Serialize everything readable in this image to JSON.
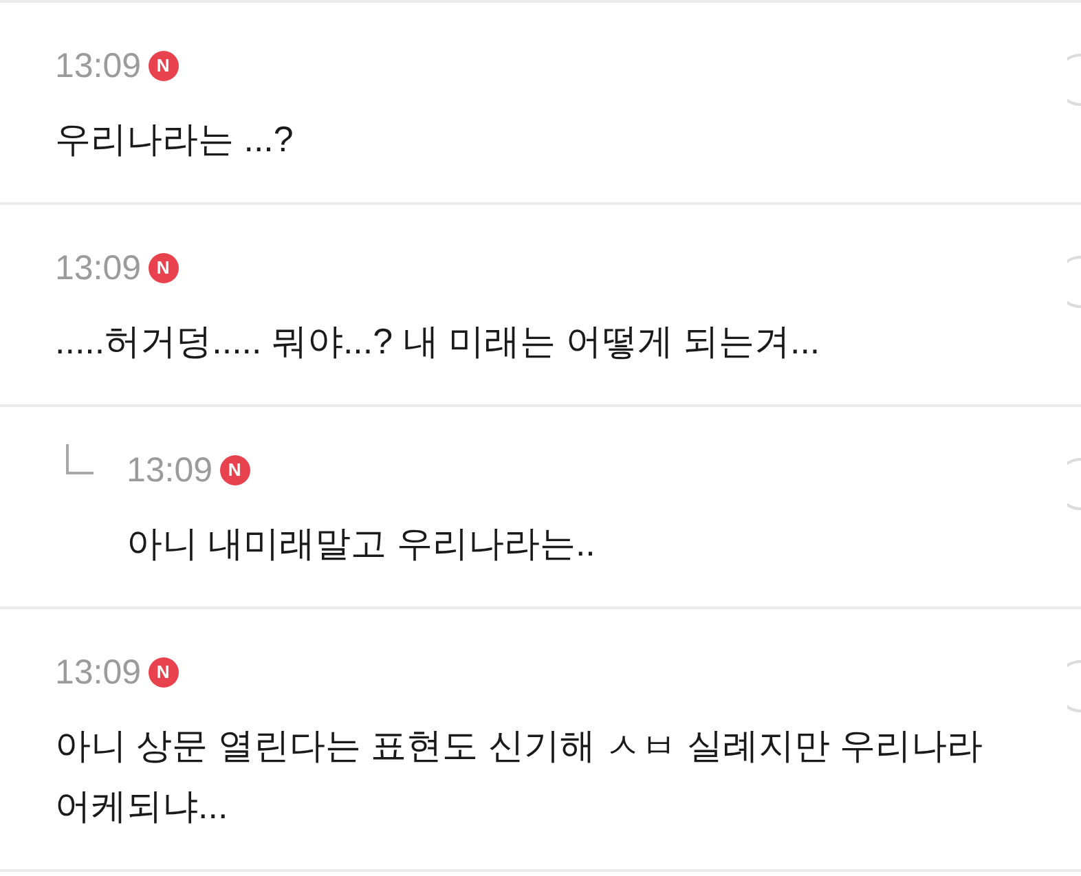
{
  "comments": [
    {
      "kind": "comment",
      "time": "13:09",
      "badge": "N",
      "text": "우리나라는 ...?"
    },
    {
      "kind": "comment",
      "time": "13:09",
      "badge": "N",
      "text": ".....허거덩..... 뭐야...? 내 미래는 어떻게 되는겨..."
    },
    {
      "kind": "reply",
      "time": "13:09",
      "badge": "N",
      "text": "아니 내미래말고 우리나라는.."
    },
    {
      "kind": "comment",
      "time": "13:09",
      "badge": "N",
      "text": "아니 상문 열린다는 표현도 신기해 ㅅㅂ 실례지만 우리나라 어케되냐..."
    }
  ]
}
